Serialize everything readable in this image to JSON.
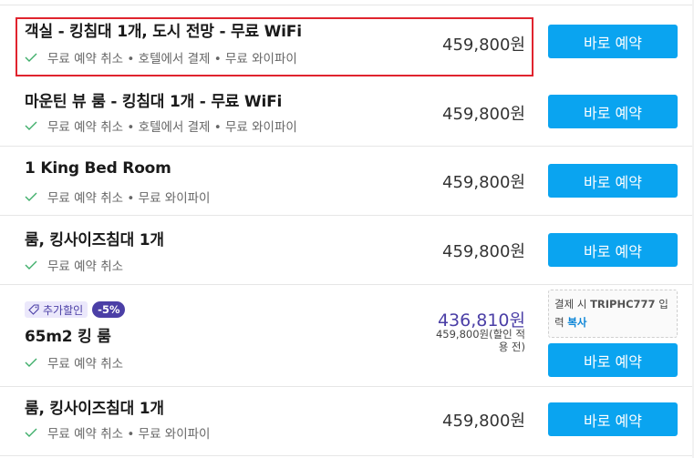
{
  "rooms": [
    {
      "name": "객실 - 킹침대 1개, 도시 전망 - 무료 WiFi",
      "amenities": "무료 예약 취소 • 호텔에서 결제 • 무료 와이파이",
      "price": "459,800원",
      "button": "바로 예약",
      "selected": true
    },
    {
      "name": "마운틴 뷰 룸 - 킹침대 1개 - 무료 WiFi",
      "amenities": "무료 예약 취소 • 호텔에서 결제 • 무료 와이파이",
      "price": "459,800원",
      "button": "바로 예약"
    },
    {
      "name": "1 King Bed Room",
      "amenities": "무료 예약 취소 • 무료 와이파이",
      "price": "459,800원",
      "button": "바로 예약"
    },
    {
      "name": "룸, 킹사이즈침대 1개",
      "amenities": "무료 예약 취소",
      "price": "459,800원",
      "button": "바로 예약"
    },
    {
      "name": "65m2 킹 룸",
      "amenities": "무료 예약 취소",
      "promo_label": "추가할인",
      "promo_percent": "-5%",
      "price": "436,810원",
      "original_price_line1": "459,800원(할인 적",
      "original_price_line2": "용 전)",
      "coupon_prefix": "결제 시 ",
      "coupon_code": "TRIPHC777",
      "coupon_suffix": " 입",
      "coupon_line2": "력 ",
      "coupon_copy": "복사",
      "button": "바로 예약"
    },
    {
      "name": "룸, 킹사이즈침대 1개",
      "amenities": "무료 예약 취소 • 무료 와이파이",
      "price": "459,800원",
      "button": "바로 예약"
    }
  ],
  "colors": {
    "button_bg": "#0aa4f0",
    "highlight_border": "#e0242e",
    "discount_price": "#4b3fa6",
    "check": "#3fae6a"
  },
  "icons": {
    "amenity": "check-icon",
    "promo": "tag-icon"
  }
}
